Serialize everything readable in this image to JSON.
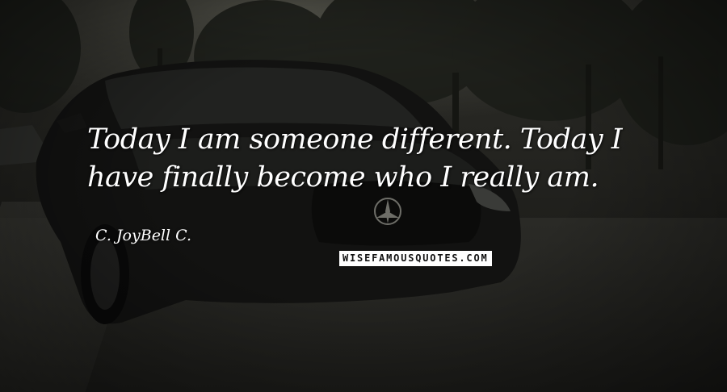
{
  "quote": {
    "line1": "Today I am someone different. Today I",
    "line2": "have finally become who I really am."
  },
  "author": "C. JoyBell C.",
  "watermark": "WISEFAMOUSQUOTES.COM",
  "colors": {
    "text": "#ffffff",
    "background": "#1e1e1b",
    "watermark_bg": "#ffffff",
    "watermark_text": "#111111"
  }
}
